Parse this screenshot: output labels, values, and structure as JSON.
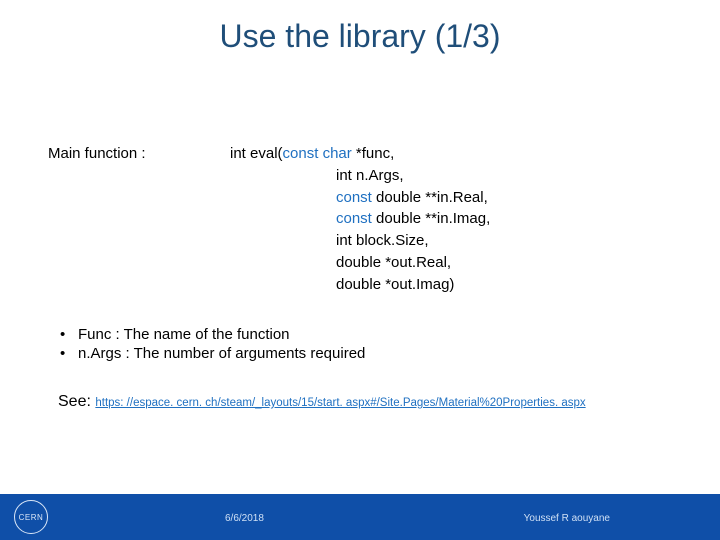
{
  "title": "Use the library (1/3)",
  "label": "Main function :",
  "signature": {
    "l1_pre": "int eval(",
    "l1_kw1": "const",
    "l1_mid": " ",
    "l1_kw2": "char",
    "l1_post": " *func,",
    "l2": "int n.Args,",
    "l3_kw": "const",
    "l3_post": " double **in.Real,",
    "l4_kw": "const",
    "l4_post": " double **in.Imag,",
    "l5": "int block.Size,",
    "l6": "double *out.Real,",
    "l7": "double *out.Imag)"
  },
  "bullets": {
    "dot": "•",
    "b1": "Func : The name of the function",
    "b2": "n.Args : The number of arguments required"
  },
  "see_label": "See: ",
  "see_url": "https: //espace. cern. ch/steam/_layouts/15/start. aspx#/Site.Pages/Material%20Properties. aspx",
  "footer": {
    "logo": "CERN",
    "date": "6/6/2018",
    "author": "Youssef R aouyane"
  }
}
